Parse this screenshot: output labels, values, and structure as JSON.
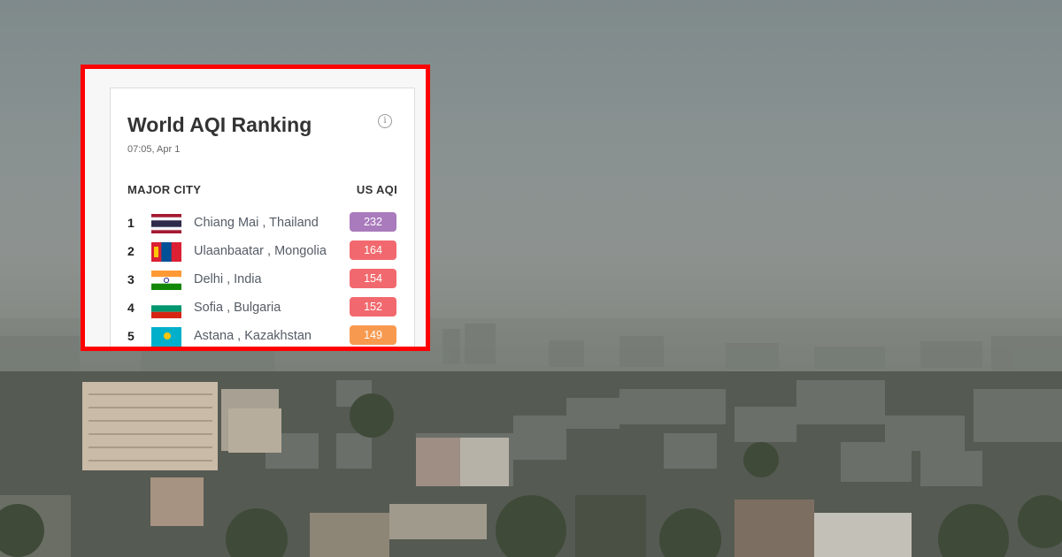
{
  "widget": {
    "title": "World AQI Ranking",
    "timestamp": "07:05, Apr 1",
    "column_city": "MAJOR CITY",
    "column_aqi": "US AQI",
    "info_icon": "info-icon",
    "highlight_color": "#ff0000"
  },
  "rankings": [
    {
      "rank": "1",
      "city": "Chiang Mai , Thailand",
      "aqi": "232",
      "color": "#a97abc",
      "flag": "thailand-flag"
    },
    {
      "rank": "2",
      "city": "Ulaanbaatar , Mongolia",
      "aqi": "164",
      "color": "#f1696e",
      "flag": "mongolia-flag"
    },
    {
      "rank": "3",
      "city": "Delhi , India",
      "aqi": "154",
      "color": "#f1696e",
      "flag": "india-flag"
    },
    {
      "rank": "4",
      "city": "Sofia , Bulgaria",
      "aqi": "152",
      "color": "#f1696e",
      "flag": "bulgaria-flag"
    },
    {
      "rank": "5",
      "city": "Astana , Kazakhstan",
      "aqi": "149",
      "color": "#f79a50",
      "flag": "kazakhstan-flag"
    }
  ]
}
